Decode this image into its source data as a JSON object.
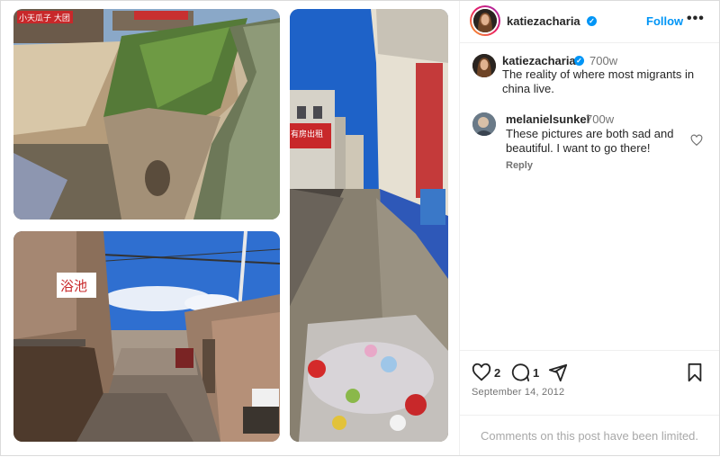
{
  "post": {
    "author": "katiezacharia",
    "follow_label": "Follow",
    "more_label": "•••",
    "caption": {
      "username": "katiezacharia",
      "time": "700w",
      "text": "The reality of where most migrants in china live."
    },
    "comments": [
      {
        "username": "melanielsunkel",
        "time": "700w",
        "text": "These pictures are both sad and beautiful. I want to go there!",
        "reply_label": "Reply"
      }
    ],
    "likes_count": "2",
    "comments_count": "1",
    "date": "September 14, 2012",
    "comments_limited": "Comments on this post have been limited.",
    "photos": {
      "canal_sign": "小天瓜子 大团",
      "alley_sign": "浴池",
      "street_sign": "有房出租"
    }
  },
  "icons": {
    "verified": "verified-badge-icon",
    "like": "heart-icon",
    "comment": "comment-icon",
    "share": "send-icon",
    "save": "bookmark-icon"
  },
  "colors": {
    "accent": "#0095f6",
    "muted": "#737373",
    "limited_text": "#a8a8a8"
  }
}
